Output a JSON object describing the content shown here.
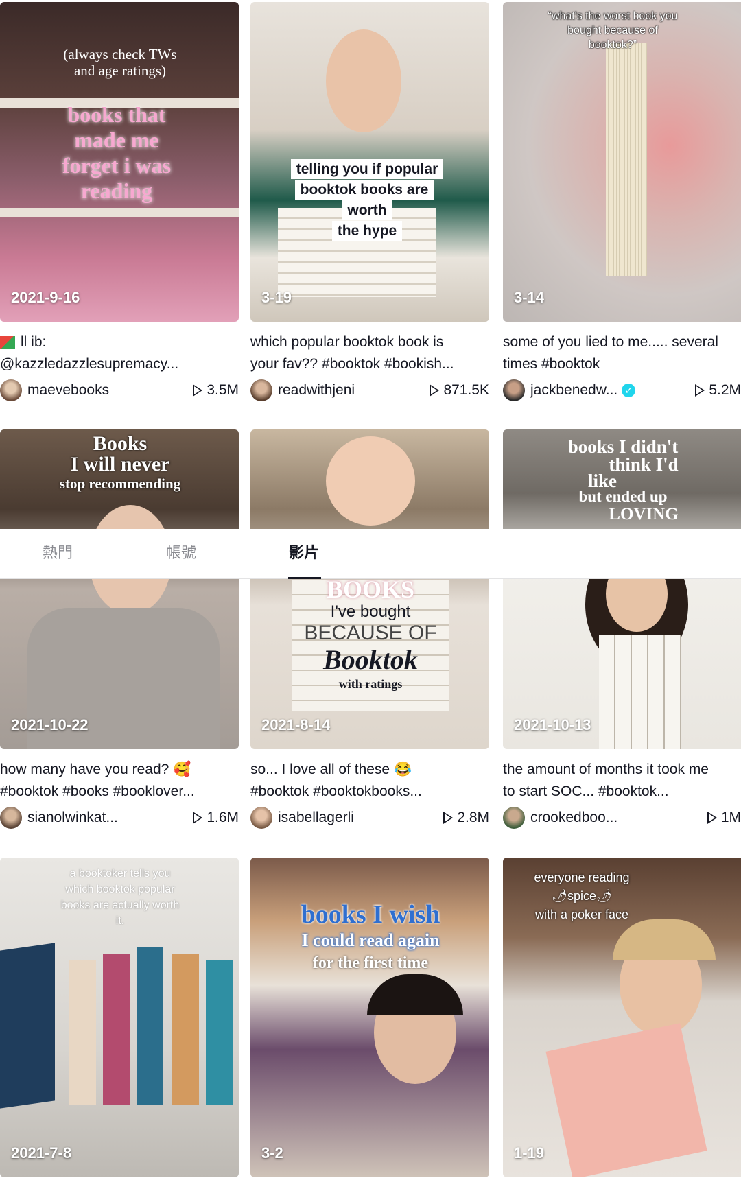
{
  "tabs": [
    "熱門",
    "帳號",
    "影片"
  ],
  "active_tab": "影片",
  "videos": [
    {
      "date": "2021-9-16",
      "overlay_lines": [
        "(always check TWs",
        "and age ratings)",
        "books that",
        "made me",
        "forget i was",
        "reading"
      ],
      "desc_line1": "ll ib:",
      "desc_line2": "@kazzledazzlesupremacy...",
      "user": "maevebooks",
      "views": "3.5M"
    },
    {
      "date": "3-19",
      "overlay_lines": [
        "telling you if popular",
        "booktok books are worth",
        "the hype"
      ],
      "desc_line1": "which popular booktok book is",
      "desc_line2": "your fav?? #booktok #bookish...",
      "user": "readwithjeni",
      "views": "871.5K"
    },
    {
      "date": "3-14",
      "overlay_lines": [
        "“what's the worst book you",
        "bought because of",
        "booktok?”"
      ],
      "desc_line1": "some of you lied to me..... several",
      "desc_line2": "times #booktok",
      "user": "jackbenedw...",
      "views": "5.2M"
    },
    {
      "date": "2021-10-22",
      "overlay_lines": [
        "Books",
        "I will never",
        "stop recommending"
      ],
      "desc_line1": "how many have you read? 🥰",
      "desc_line2": "#booktok #books #booklover...",
      "user": "sianolwinkat...",
      "views": "1.6M"
    },
    {
      "date": "2021-8-14",
      "overlay_lines": [
        "BOOKS",
        "I've bought",
        "BECAUSE OF",
        "Booktok",
        "with ratings"
      ],
      "desc_line1": "so... I love all of these 😂",
      "desc_line2": "#booktok #booktokbooks...",
      "user": "isabellagerli",
      "views": "2.8M"
    },
    {
      "date": "2021-10-13",
      "overlay_lines": [
        "books I didn't",
        "think I'd",
        "like",
        "but ended up",
        "LOVING"
      ],
      "desc_line1": "the amount of months it took me",
      "desc_line2": "to start SOC... #booktok...",
      "user": "crookedboo...",
      "views": "1M"
    },
    {
      "date": "2021-7-8",
      "overlay_lines": [
        "a booktoker tells you",
        "which booktok popular",
        "books are actually worth",
        "it."
      ]
    },
    {
      "date": "3-2",
      "overlay_lines": [
        "books I wish",
        "I could read again",
        "for the first time"
      ]
    },
    {
      "date": "1-19",
      "overlay_lines": [
        "everyone reading",
        "🌶spice🌶",
        "with a poker face"
      ]
    }
  ],
  "colors": {
    "accent_pink": "#f7a8d0",
    "verified": "#20d5ec"
  }
}
